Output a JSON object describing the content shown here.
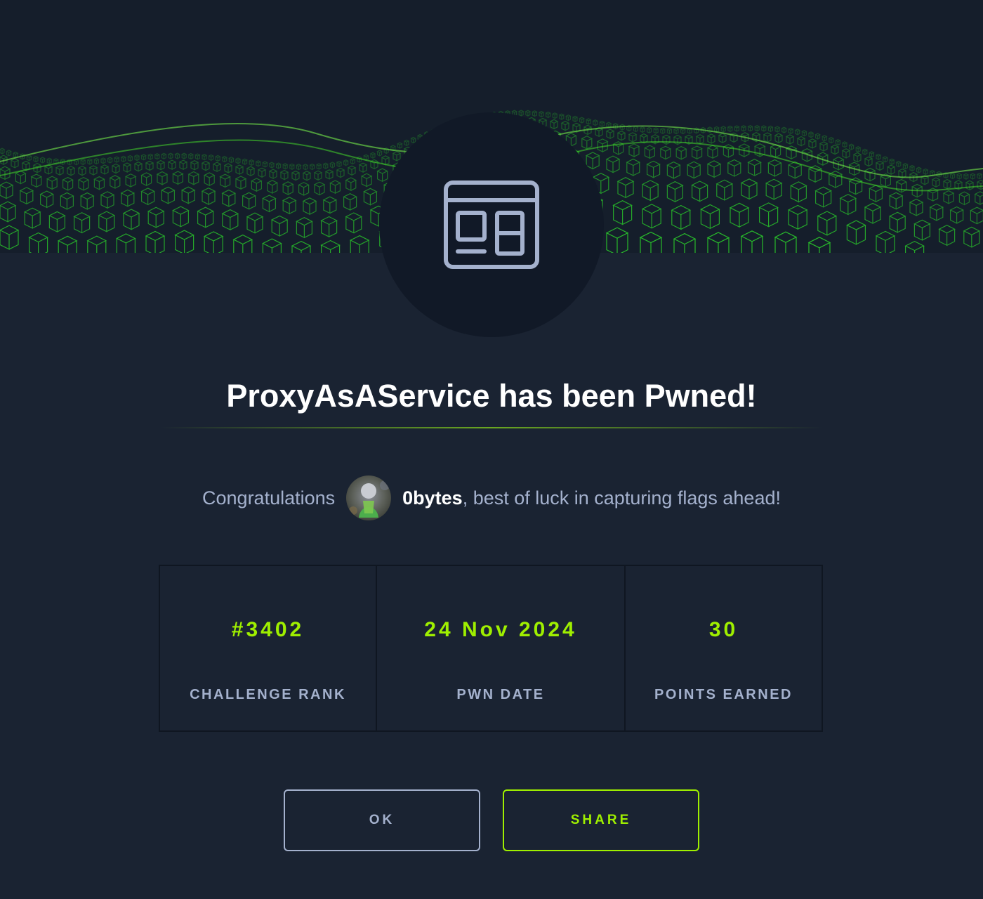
{
  "modal": {
    "title": "ProxyAsAService has been Pwned!",
    "congrats_prefix": "Congratulations",
    "username": "0bytes",
    "congrats_suffix": ", best of luck in capturing flags ahead!"
  },
  "stats": [
    {
      "value": "#3402",
      "label": "CHALLENGE RANK"
    },
    {
      "value": "24 Nov 2024",
      "label": "PWN DATE"
    },
    {
      "value": "30",
      "label": "POINTS EARNED"
    }
  ],
  "buttons": {
    "ok_label": "OK",
    "share_label": "SHARE"
  },
  "icons": {
    "challenge_category": "web-browser-window-icon",
    "avatar": "user-avatar"
  },
  "colors": {
    "background": "#1a2332",
    "accent": "#9fef00",
    "muted_text": "#a4b1cd",
    "banner_green": "#39ff14"
  }
}
